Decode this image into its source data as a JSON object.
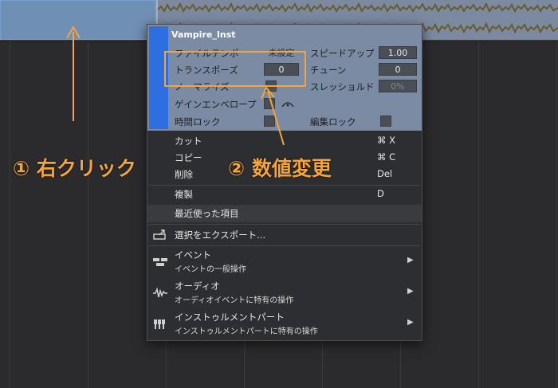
{
  "clip": {
    "name": "Vampire_Inst"
  },
  "properties": {
    "file_tempo_label": "ファイルテンポ",
    "file_tempo_value": "未設定",
    "speedup_label": "スピードアップ",
    "speedup_value": "1.00",
    "transpose_label": "トランスポーズ",
    "transpose_value": "0",
    "tune_label": "チューン",
    "tune_value": "0",
    "normalize_label": "ノーマライズ",
    "threshold_label": "スレッショルド",
    "threshold_value": "0%",
    "gain_envelope_label": "ゲインエンベロープ",
    "time_lock_label": "時間ロック",
    "edit_lock_label": "編集ロック"
  },
  "menu": {
    "cut_label": "カット",
    "cut_shortcut": "⌘ X",
    "copy_label": "コピー",
    "copy_shortcut": "⌘ C",
    "delete_label": "削除",
    "delete_shortcut": "Del",
    "duplicate_label": "複製",
    "duplicate_shortcut": "D",
    "recent_label": "最近使った項目",
    "export_label": "選択をエクスポート...",
    "event_label": "イベント",
    "event_sub": "イベントの一般操作",
    "audio_label": "オーディオ",
    "audio_sub": "オーディオイベントに特有の操作",
    "instrument_label": "インストゥルメントパート",
    "instrument_sub": "インストゥルメントパートに特有の操作"
  },
  "annotations": {
    "step1": "① 右クリック",
    "step2": "② 数値変更",
    "color": "#f4a43a"
  },
  "colors": {
    "accent": "#2d6fe0",
    "header_bg": "#7b8ba3",
    "menu_bg": "#2d2e31"
  }
}
